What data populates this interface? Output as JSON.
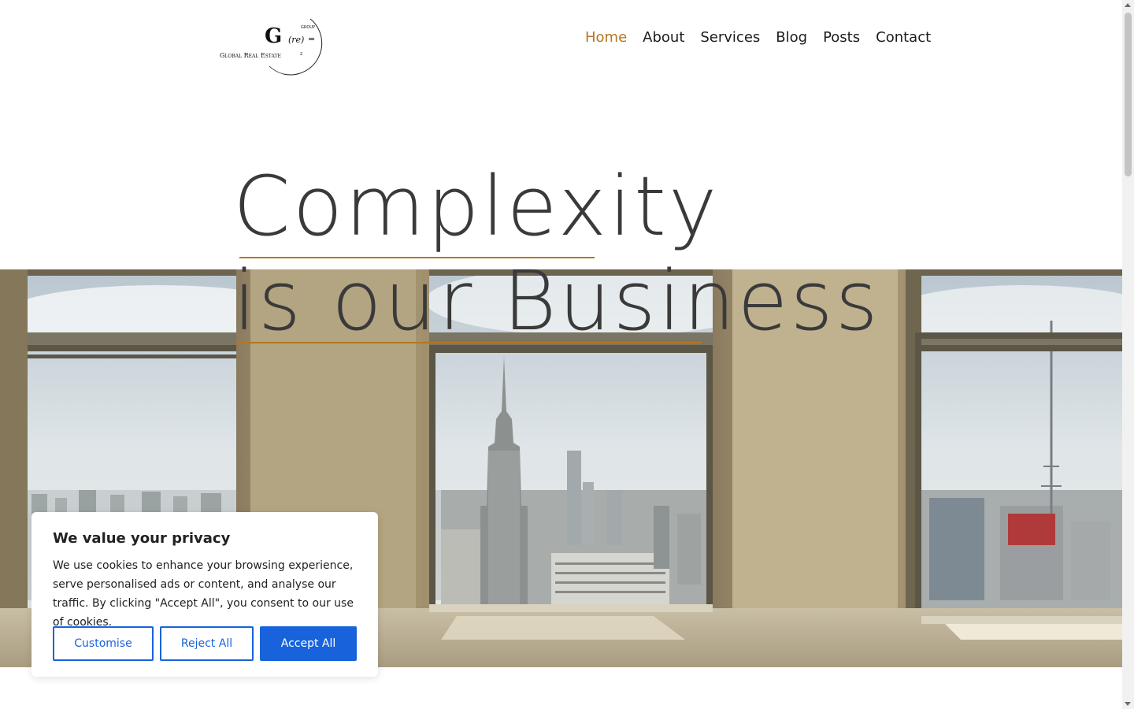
{
  "header": {
    "logo": {
      "letter": "G",
      "re": "(re)",
      "equals": "=",
      "group": "GROUP",
      "name": "Global Real Estate",
      "superscript": "2"
    },
    "nav": [
      {
        "label": "Home",
        "active": true
      },
      {
        "label": "About",
        "active": false
      },
      {
        "label": "Services",
        "active": false
      },
      {
        "label": "Blog",
        "active": false
      },
      {
        "label": "Posts",
        "active": false
      },
      {
        "label": "Contact",
        "active": false
      }
    ]
  },
  "hero": {
    "line1": "Complexity",
    "line2": "is our Business",
    "accent_color": "#b5761f"
  },
  "cookie_banner": {
    "title": "We value your privacy",
    "text": "We use cookies to enhance your browsing experience, serve personalised ads or content, and analyse our traffic. By clicking \"Accept All\", you consent to our use of cookies.",
    "customise_label": "Customise",
    "reject_label": "Reject All",
    "accept_label": "Accept All",
    "button_color": "#1863dc"
  },
  "colors": {
    "nav_active": "#b5761f",
    "nav_default": "#1c1c1c",
    "headline": "#3a3a3a"
  }
}
